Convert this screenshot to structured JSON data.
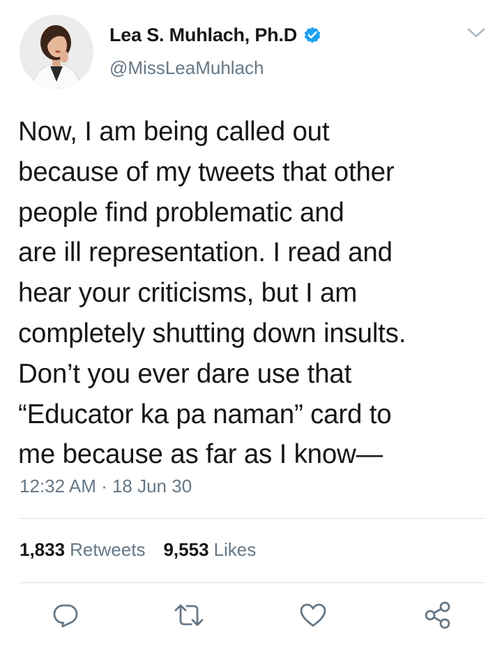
{
  "user": {
    "display_name": "Lea S. Muhlach, Ph.D",
    "handle": "@MissLeaMuhlach",
    "verified_icon": "verified-badge-icon",
    "avatar_icon": "profile-photo"
  },
  "tweet": {
    "text": "Now, I am being called out\nbecause of my tweets that other\npeople find problematic and\nare ill representation. I read and\nhear your criticisms, but I am\ncompletely shutting down insults.\nDon’t you ever dare use that\n“Educator ka pa naman” card to\nme because as far as I know—",
    "timestamp": "12:32 AM · 18 Jun 30"
  },
  "stats": {
    "retweets_count": "1,833",
    "retweets_label": "Retweets",
    "likes_count": "9,553",
    "likes_label": "Likes"
  },
  "actions": {
    "reply_icon": "reply-icon",
    "retweet_icon": "retweet-icon",
    "like_icon": "heart-icon",
    "share_icon": "share-icon"
  },
  "colors": {
    "accent": "#1da1f2",
    "text_primary": "#14171a",
    "text_secondary": "#657786",
    "divider": "#dcdfe2"
  }
}
